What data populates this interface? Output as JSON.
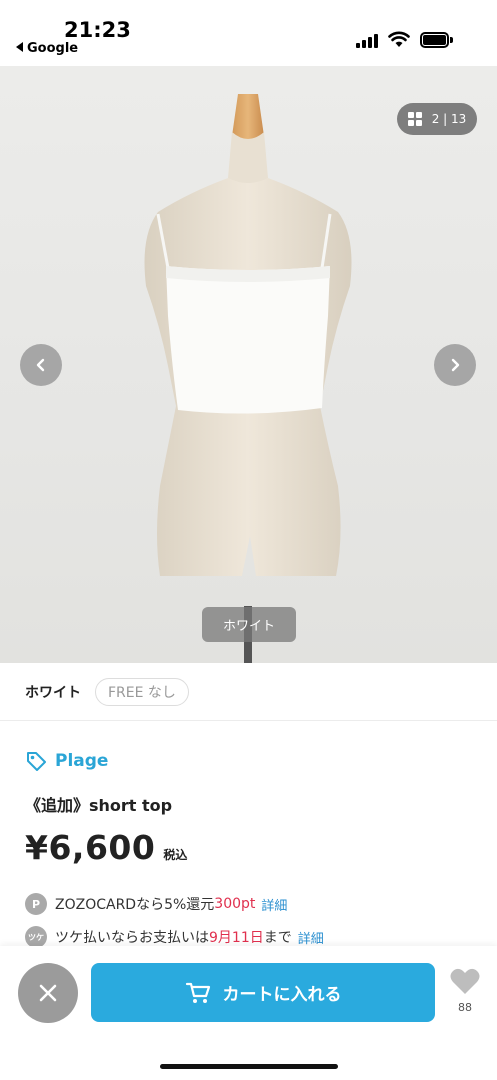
{
  "status_bar": {
    "time": "21:23",
    "back_label": "Google"
  },
  "gallery": {
    "counter_current": "2",
    "counter_total": "13",
    "separator": "|",
    "color_tag": "ホワイト"
  },
  "variant": {
    "color": "ホワイト",
    "size_chip": "FREE なし"
  },
  "product": {
    "brand": "Plage",
    "title": "《追加》short top",
    "price": "¥6,600",
    "tax_label": "税込"
  },
  "info": {
    "zozo_icon": "P",
    "zozo_text": "ZOZOCARDなら5%還元 ",
    "zozo_points": "300pt",
    "zozo_detail": "詳細",
    "tsuke_icon": "ツケ",
    "tsuke_text_1": "ツケ払いならお支払いは",
    "tsuke_date": "9月11日",
    "tsuke_text_2": "まで",
    "tsuke_detail": "詳細"
  },
  "bottom_bar": {
    "cart_label": "カートに入れる",
    "favorite_count": "88"
  },
  "colors": {
    "accent": "#2aaade",
    "brand_blue": "#2aa5d6",
    "highlight_red": "#e0304e",
    "close_gray": "#9b9b9b"
  }
}
